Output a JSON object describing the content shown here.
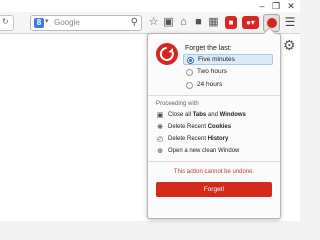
{
  "search": {
    "placeholder": "Google",
    "engine_icon": "google-icon"
  },
  "panel": {
    "forget_label": "Forget the last:",
    "options": [
      {
        "label": "Five minutes",
        "selected": true
      },
      {
        "label": "Two hours",
        "selected": false
      },
      {
        "label": "24 hours",
        "selected": false
      }
    ],
    "proceeding_label": "Proceeding with",
    "actions": [
      {
        "pre": "Close all ",
        "b1": "Tabs",
        "mid": " and ",
        "b2": "Windows",
        "icon": "windows-icon"
      },
      {
        "pre": "Delete Recent ",
        "b1": "Cookies",
        "mid": "",
        "b2": "",
        "icon": "cookie-icon"
      },
      {
        "pre": "Delete Recent ",
        "b1": "History",
        "mid": "",
        "b2": "",
        "icon": "history-icon"
      },
      {
        "pre": "Open a new clean Window",
        "b1": "",
        "mid": "",
        "b2": "",
        "icon": "new-window-icon"
      }
    ],
    "warning": "This action cannot be undone.",
    "forget_button": "Forget!"
  },
  "colors": {
    "accent": "#d7261f",
    "selected_bg": "#dce9f7"
  }
}
